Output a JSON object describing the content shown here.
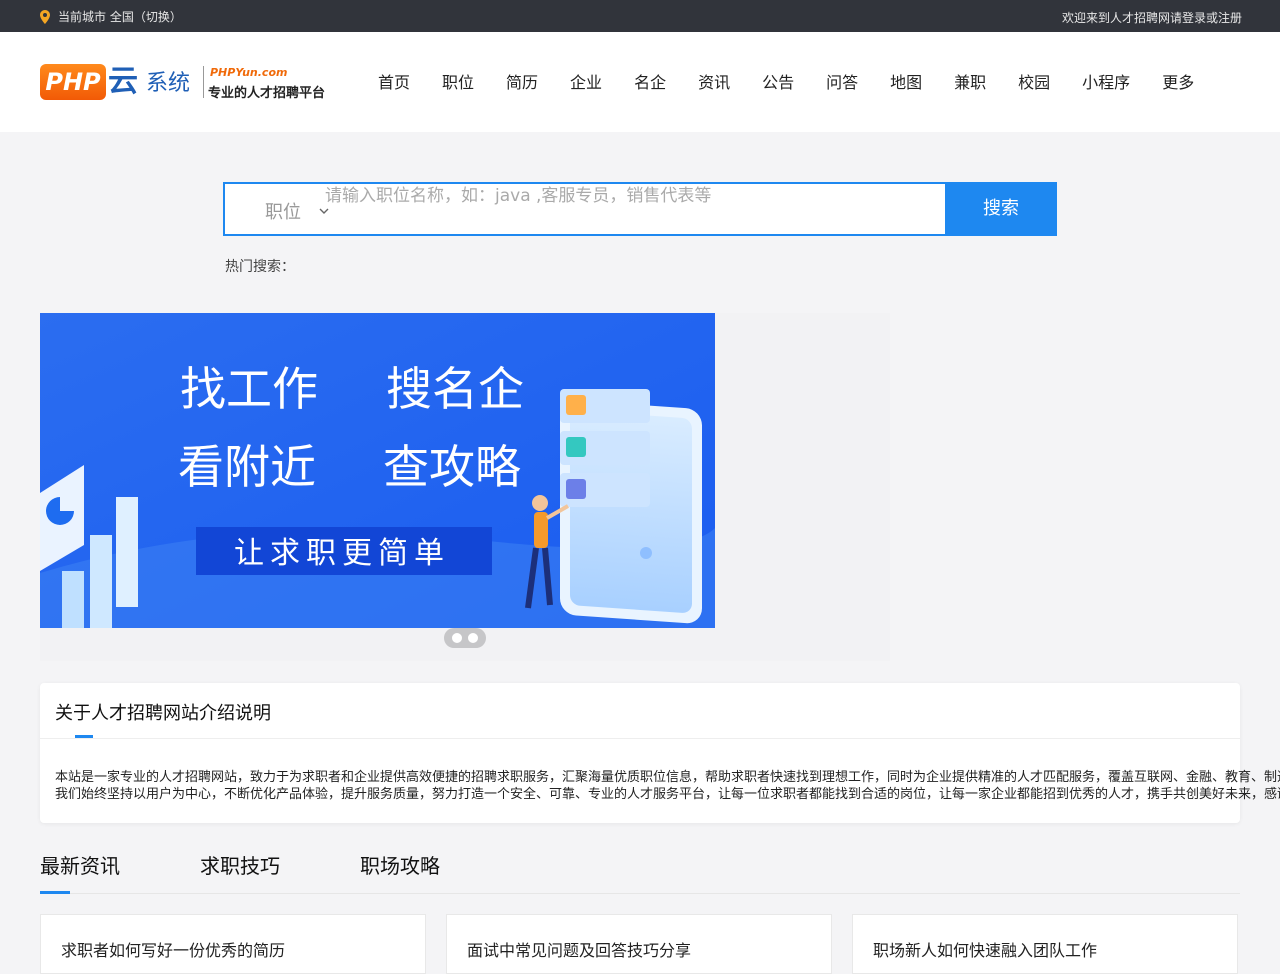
{
  "topbar": {
    "location": "当前城市 全国（切换）",
    "right_text": "欢迎来到人才招聘网请登录或注册"
  },
  "logo": {
    "php": "PHP",
    "yun": "云",
    "sys": "系统",
    "site": "PHPYun.com",
    "slogan": "专业的人才招聘平台"
  },
  "nav": {
    "items": [
      "首页",
      "职位",
      "简历",
      "企业",
      "名企",
      "资讯",
      "公告",
      "问答",
      "地图",
      "兼职",
      "校园",
      "小程序",
      "更多"
    ]
  },
  "search": {
    "type_label": "职位",
    "placeholder": "请输入职位名称，如：java ,客服专员，销售代表等",
    "button": "搜索"
  },
  "hot": {
    "label": "热门搜索："
  },
  "banner": {
    "line1_left": "找工作",
    "line1_right": "搜名企",
    "line2_left": "看附近",
    "line2_right": "查攻略",
    "tagline": "让求职更简单"
  },
  "intro": {
    "title": "关于人才招聘网站介绍说明",
    "line1": "本站是一家专业的人才招聘网站，致力于为求职者和企业提供高效便捷的招聘求职服务，汇聚海量优质职位信息，帮助求职者快速找到理想工作，同时为企业提供精准的人才匹配服务，覆盖互联网、金融、教育、制造、医疗、房地产、服务业等多个行业领域，网站提供职位搜索、简历投递、在线沟通、名企推荐、校园招聘、兼职信息等功能，欢迎广大求职者与企业用户加入",
    "line2": "我们始终坚持以用户为中心，不断优化产品体验，提升服务质量，努力打造一个安全、可靠、专业的人才服务平台，让每一位求职者都能找到合适的岗位，让每一家企业都能招到优秀的人才，携手共创美好未来，感谢您的支持与信任"
  },
  "tabs": {
    "items": [
      "最新资讯",
      "求职技巧",
      "职场攻略"
    ]
  },
  "cards": {
    "items": [
      "求职者如何写好一份优秀的简历",
      "面试中常见问题及回答技巧分享",
      "职场新人如何快速融入团队工作"
    ]
  },
  "colors": {
    "accent": "#1e88f0",
    "topbar": "#31343b",
    "orange": "#f5a623"
  }
}
